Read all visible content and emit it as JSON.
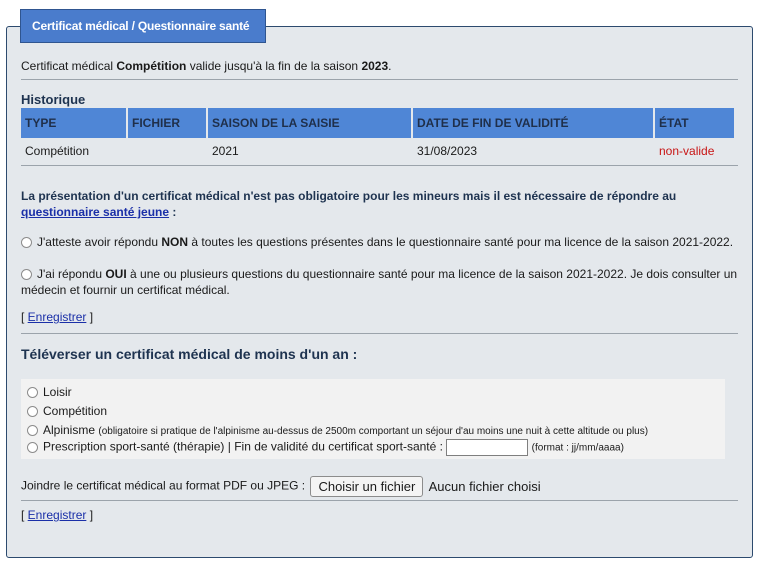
{
  "tab_title": "Certificat médical / Questionnaire santé",
  "validity": {
    "prefix": "Certificat médical ",
    "type": "Compétition",
    "middle": " valide jusqu'à la fin de la saison ",
    "season": "2023",
    "suffix": "."
  },
  "history": {
    "title": "Historique",
    "columns": [
      "TYPE",
      "FICHIER",
      "SAISON DE LA SAISIE",
      "DATE DE FIN DE VALIDITÉ",
      "ÉTAT"
    ],
    "rows": [
      {
        "type": "Compétition",
        "file": "",
        "season": "2021",
        "end_date": "31/08/2023",
        "state": "non-valide"
      }
    ]
  },
  "info": {
    "text": "La présentation d'un certificat médical n'est pas obligatoire pour les mineurs mais il est nécessaire de répondre au ",
    "link": "questionnaire santé jeune",
    "suffix": " :"
  },
  "attest_no": {
    "pre": "J'atteste avoir répondu ",
    "bold": "NON",
    "post": " à toutes les questions présentes dans le questionnaire santé pour ma licence de la saison 2021-2022."
  },
  "attest_yes": {
    "pre": "J'ai répondu ",
    "bold": "OUI",
    "post": " à une ou plusieurs questions du questionnaire santé pour ma licence de la saison 2021-2022. Je dois consulter un médecin et fournir un certificat médical."
  },
  "save": {
    "open": "[ ",
    "label": "Enregistrer",
    "close": " ]"
  },
  "upload": {
    "title": "Téléverser un certificat médical de moins d'un an :",
    "options": {
      "loisir": "Loisir",
      "competition": "Compétition",
      "alpinisme": "Alpinisme",
      "alpinisme_note": "(obligatoire si pratique de l'alpinisme au-dessus de 2500m comportant un séjour d'au moins une nuit à cette altitude ou plus)",
      "prescription": "Prescription sport-santé (thérapie) | Fin de validité du certificat sport-santé :",
      "date_format": "(format : jj/mm/aaaa)"
    },
    "join_label": "Joindre le certificat médical au format PDF ou JPEG :",
    "file_button": "Choisir un fichier",
    "no_file": "Aucun fichier choisi"
  }
}
